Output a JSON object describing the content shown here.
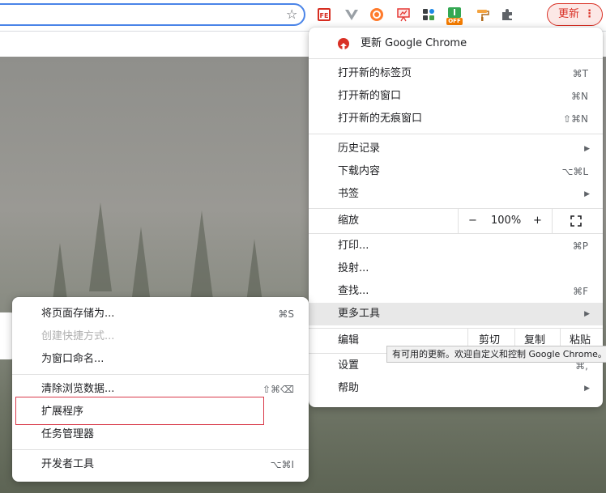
{
  "toolbar": {
    "bookmark_icon": "star-outline",
    "extensions": [
      "fe-helper-icon",
      "vue-devtools-icon",
      "bullseye-icon",
      "whiteboard-icon",
      "apps-grid-icon",
      "android-off-icon",
      "paint-roller-icon",
      "puzzle-icon"
    ],
    "android_off_badge": "OFF",
    "fe_text": "FE",
    "update_label": "更新",
    "menu_dots": "⋮"
  },
  "main_menu": {
    "update_item": "更新 Google Chrome",
    "new_tab": {
      "label": "打开新的标签页",
      "shortcut": "⌘T"
    },
    "new_window": {
      "label": "打开新的窗口",
      "shortcut": "⌘N"
    },
    "new_incognito": {
      "label": "打开新的无痕窗口",
      "shortcut": "⇧⌘N"
    },
    "history": {
      "label": "历史记录"
    },
    "downloads": {
      "label": "下载内容",
      "shortcut": "⌥⌘L"
    },
    "bookmarks": {
      "label": "书签"
    },
    "zoom": {
      "label": "缩放",
      "minus": "−",
      "value": "100%",
      "plus": "+"
    },
    "print": {
      "label": "打印...",
      "shortcut": "⌘P"
    },
    "cast": {
      "label": "投射..."
    },
    "find": {
      "label": "查找...",
      "shortcut": "⌘F"
    },
    "more_tools": {
      "label": "更多工具"
    },
    "edit": {
      "label": "编辑",
      "cut": "剪切",
      "copy": "复制",
      "paste": "粘贴"
    },
    "settings": {
      "label": "设置",
      "shortcut": "⌘,"
    },
    "help": {
      "label": "帮助"
    }
  },
  "sub_menu": {
    "save_page": {
      "label": "将页面存储为...",
      "shortcut": "⌘S"
    },
    "create_shortcut": {
      "label": "创建快捷方式..."
    },
    "name_window": {
      "label": "为窗口命名..."
    },
    "clear_data": {
      "label": "清除浏览数据...",
      "shortcut": "⇧⌘⌫"
    },
    "extensions": {
      "label": "扩展程序"
    },
    "task_manager": {
      "label": "任务管理器"
    },
    "dev_tools": {
      "label": "开发者工具",
      "shortcut": "⌥⌘I"
    }
  },
  "tooltip": "有可用的更新。欢迎自定义和控制 Google Chrome。",
  "colors": {
    "accent": "#1a73e8",
    "update_red": "#d93025",
    "highlight": "#e8e8e8"
  }
}
